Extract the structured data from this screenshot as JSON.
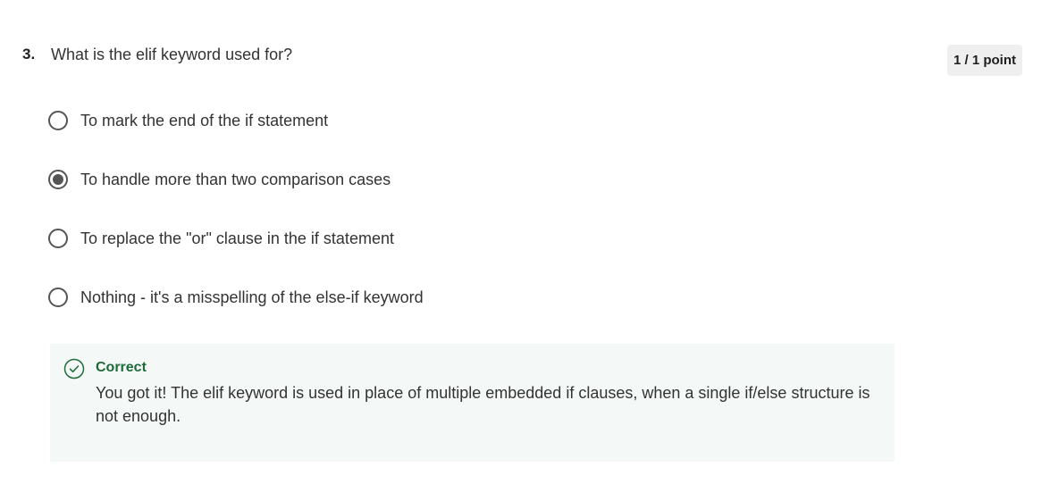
{
  "question": {
    "number": "3.",
    "text": "What is the elif keyword used for?",
    "score": "1 / 1 point"
  },
  "options": [
    {
      "label": "To mark the end of the if statement",
      "selected": false
    },
    {
      "label": "To handle more than two comparison cases",
      "selected": true
    },
    {
      "label": "To replace the \"or\" clause in the if statement",
      "selected": false
    },
    {
      "label": "Nothing - it's a misspelling of the else-if keyword",
      "selected": false
    }
  ],
  "feedback": {
    "icon": "check-circle-icon",
    "title": "Correct",
    "body": "You got it! The elif keyword is used in place of multiple embedded if clauses, when a single if/else structure is not enough.",
    "color": "#1e6b3a",
    "background": "#f4f8f6"
  }
}
